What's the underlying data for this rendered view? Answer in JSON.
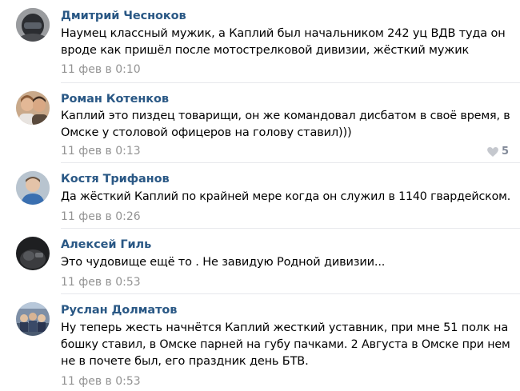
{
  "comments": [
    {
      "author": "Дмитрий Чесноков",
      "avatar_icon": "user-avatar-helmet",
      "lines": [
        "Наумец классный мужик, а Каплий был начальником 242 уц ВДВ туда он",
        "вроде как пришёл после мотострелковой дивизии, жёсткий мужик"
      ],
      "date": "11 фев в 0:10"
    },
    {
      "author": "Роман Котенков",
      "avatar_icon": "user-avatar-couple",
      "lines": [
        "Каплий это пиздец товарищи, он же командовал дисбатом в своё время, в",
        "Омске у столовой офицеров на голову ставил)))"
      ],
      "date": "11 фев в 0:13",
      "likes": {
        "count": "5",
        "icon": "heart-icon"
      }
    },
    {
      "author": "Костя Трифанов",
      "avatar_icon": "user-avatar-man",
      "lines": [
        "Да жёсткий Каплий по крайней мере когда он служил в 1140 гвардейском."
      ],
      "date": "11 фев в 0:26"
    },
    {
      "author": "Алексей Гиль",
      "avatar_icon": "user-avatar-dark",
      "lines": [
        "Это чудовище ещё то . Не завидую Родной дивизии..."
      ],
      "date": "11 фев в 0:53"
    },
    {
      "author": "Руслан Долматов",
      "avatar_icon": "user-avatar-group",
      "lines": [
        "Ну теперь жесть начнётся Каплий жесткий уставник, при мне 51 полк на",
        "бошку ставил, в Омске парней на губу пачками. 2 Августа в Омске при нем",
        "не в почете был, его праздник день БТВ."
      ],
      "date": "11 фев в 0:53"
    }
  ]
}
